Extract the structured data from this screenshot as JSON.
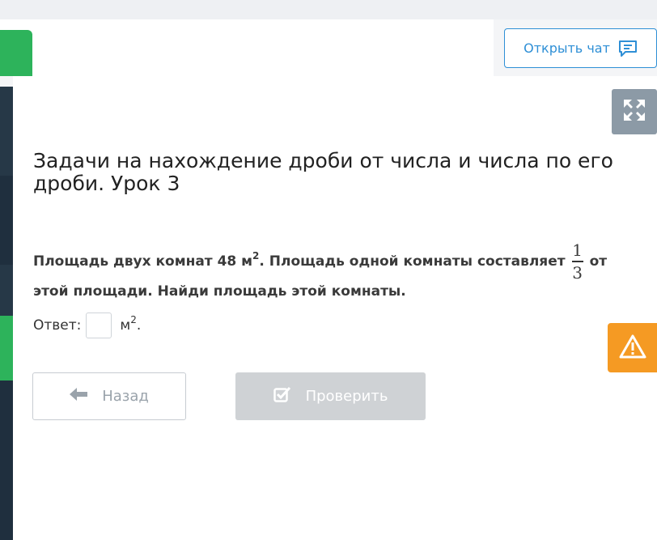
{
  "header": {
    "chat_button_label": "Открыть чат",
    "chat_icon": "chat-bubble-icon",
    "expand_icon": "expand-arrows-icon"
  },
  "lesson": {
    "title": "Задачи на нахождение дроби от числа и числа по его дроби. Урок 3"
  },
  "question": {
    "text_part1": "Площадь двух комнат 48 м",
    "text_sup": "2",
    "text_part2": ". Площадь одной комнаты составляет",
    "fraction_numerator": "1",
    "fraction_denominator": "3",
    "text_part3": "от",
    "text_line2": "этой площади. Найди площадь этой комнаты."
  },
  "answer": {
    "label": "Ответ:",
    "value": "",
    "unit": "м",
    "unit_sup": "2",
    "unit_suffix": "."
  },
  "buttons": {
    "back_label": "Назад",
    "back_icon": "arrow-left-icon",
    "check_label": "Проверить",
    "check_icon": "check-square-icon",
    "warning_icon": "warning-triangle-icon"
  },
  "colors": {
    "accent_blue": "#2e8fd6",
    "accent_green": "#2db35b",
    "warning_orange": "#f59a23",
    "sidebar_dark": "#1f2f3e"
  }
}
